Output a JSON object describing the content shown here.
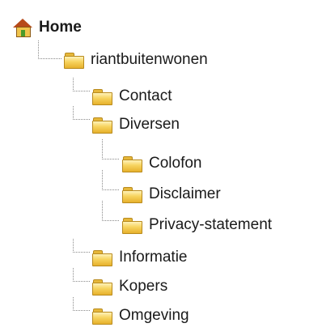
{
  "tree": {
    "home": {
      "label": "Home",
      "icon": "home-icon"
    },
    "root": {
      "label": "riantbuitenwonen",
      "icon": "folder-icon"
    },
    "items": [
      {
        "label": "Contact"
      },
      {
        "label": "Diversen"
      },
      {
        "label": "Colofon"
      },
      {
        "label": "Disclaimer"
      },
      {
        "label": "Privacy-statement"
      },
      {
        "label": "Informatie"
      },
      {
        "label": "Kopers"
      },
      {
        "label": "Omgeving"
      }
    ]
  },
  "colors": {
    "folder": "#f7d45f",
    "roof": "#b74a1a",
    "connector": "#8a8a8a"
  }
}
